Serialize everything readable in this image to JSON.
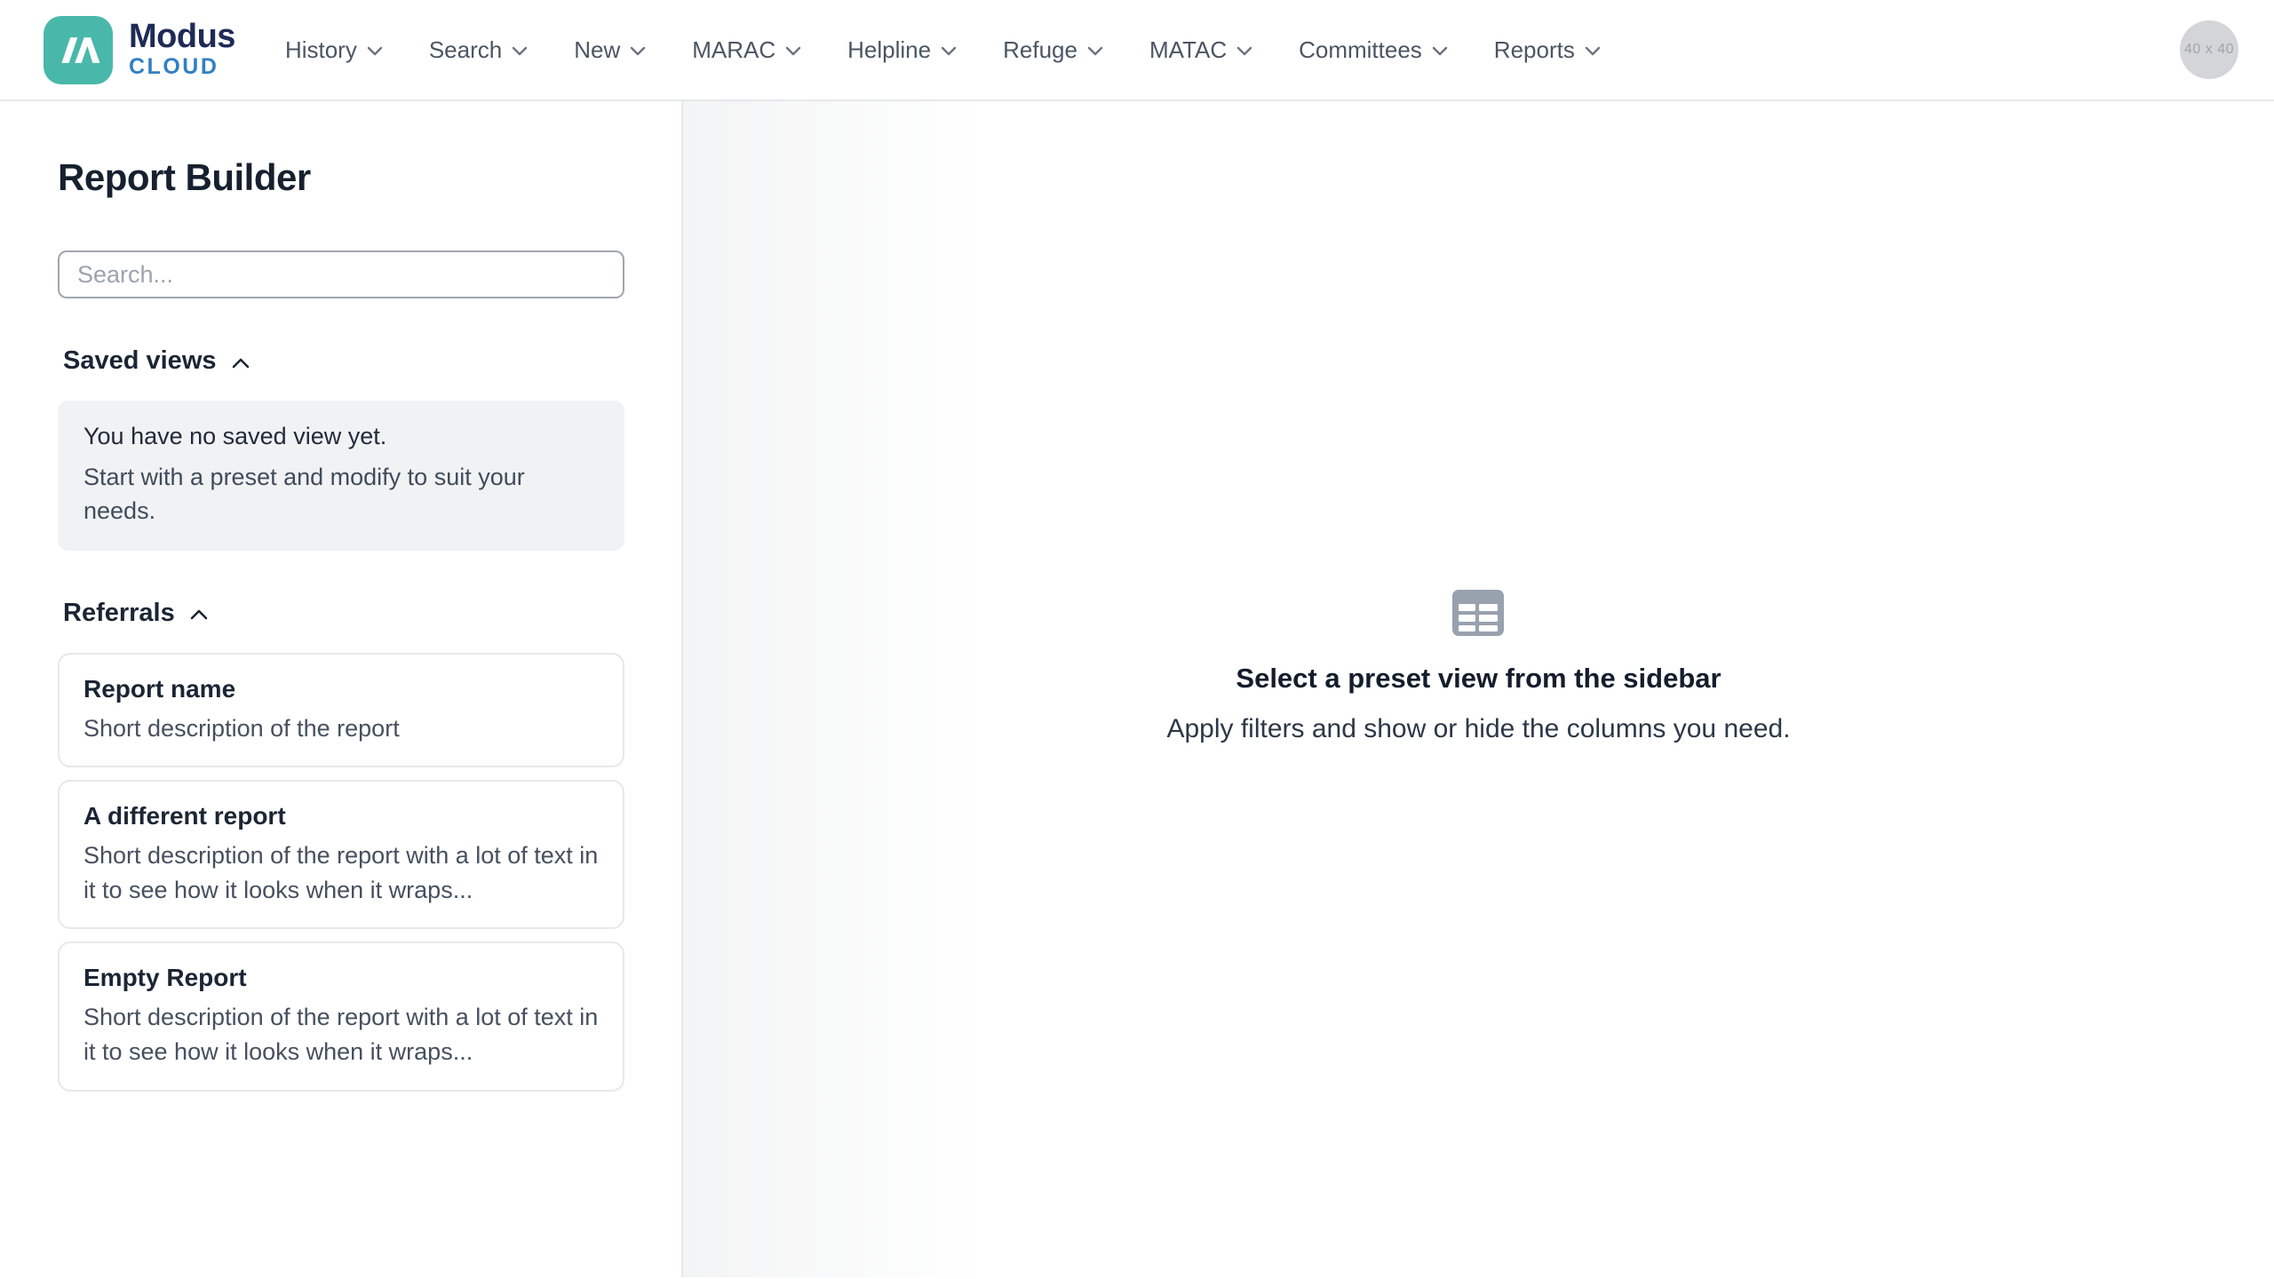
{
  "header": {
    "logo": {
      "brand": "Modus",
      "sub": "CLOUD"
    },
    "nav": [
      "History",
      "Search",
      "New",
      "MARAC",
      "Helpline",
      "Refuge",
      "MATAC",
      "Committees",
      "Reports"
    ],
    "avatar_placeholder": "40 x 40"
  },
  "sidebar": {
    "title": "Report Builder",
    "search": {
      "placeholder": "Search..."
    },
    "saved_views": {
      "label": "Saved views",
      "empty_title": "You have no saved view yet.",
      "empty_body": "Start with a preset and modify to suit your needs."
    },
    "referrals": {
      "label": "Referrals",
      "reports": [
        {
          "title": "Report name",
          "description": "Short description of the report"
        },
        {
          "title": "A different report",
          "description": "Short description of the report with a lot of text in it to see how it looks when it wraps..."
        },
        {
          "title": "Empty Report",
          "description": "Short description of the report with a lot of text in it to see how it looks when it wraps..."
        }
      ]
    }
  },
  "main": {
    "empty_state": {
      "title": "Select a preset view from the sidebar",
      "subtitle": "Apply filters and show or hide the columns you need."
    }
  },
  "colors": {
    "brand_teal": "#49b8aa",
    "brand_navy": "#1f2b56",
    "brand_blue": "#3180c3",
    "nav_text": "#4b5563",
    "border": "#e7e8ea",
    "muted_box_bg": "#f1f2f4",
    "icon_grey": "#98a1ae"
  }
}
